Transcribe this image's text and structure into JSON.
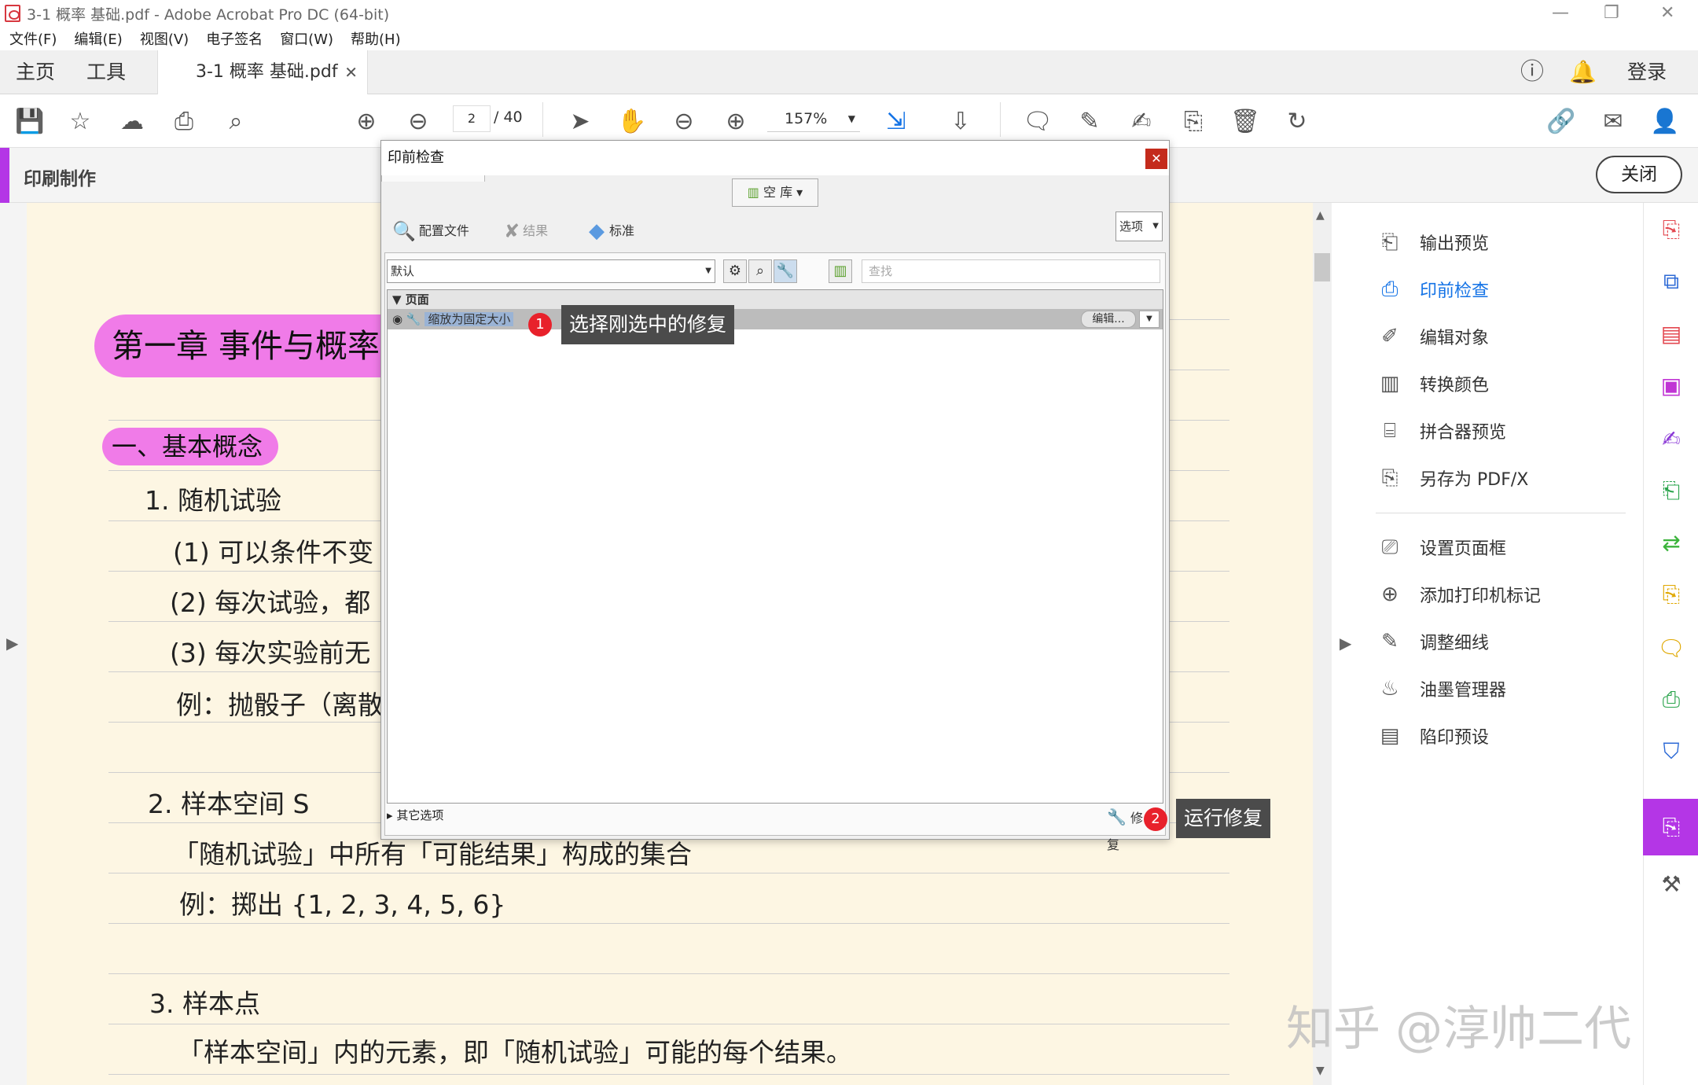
{
  "window": {
    "title": "3-1 概率 基础.pdf - Adobe Acrobat Pro DC (64-bit)"
  },
  "menu": [
    "文件(F)",
    "编辑(E)",
    "视图(V)",
    "电子签名",
    "窗口(W)",
    "帮助(H)"
  ],
  "tabs": {
    "home": "主页",
    "tools": "工具",
    "doc": "3-1 概率 基础.pdf",
    "login": "登录"
  },
  "toolbar": {
    "page_current": "2",
    "page_total": "/ 40",
    "zoom": "157%"
  },
  "printbar": {
    "label": "印刷制作",
    "close": "关闭"
  },
  "document": {
    "chapter": "第一章 事件与概率",
    "section": "一、基本概念",
    "lines": [
      "1. 随机试验",
      "(1) 可以条件不变",
      "(2) 每次试验，都",
      "(3) 每次实验前无",
      "例：抛骰子（离散",
      "2. 样本空间 S",
      "「随机试验」中所有「可能结果」构成的集合",
      "例：掷出 {1, 2, 3, 4, 5, 6}",
      "3. 样本点",
      "「样本空间」内的元素，即「随机试验」可能的每个结果。"
    ]
  },
  "right_panel": {
    "items": [
      "输出预览",
      "印前检查",
      "编辑对象",
      "转换颜色",
      "拼合器预览",
      "另存为 PDF/X",
      "设置页面框",
      "添加打印机标记",
      "调整细线",
      "油墨管理器",
      "陷印预设"
    ]
  },
  "dialog": {
    "title": "印前检查",
    "library": "空 库",
    "tab_profiles": "配置文件",
    "tab_results": "结果",
    "tab_standards": "标准",
    "options": "选项",
    "profile_select": "默认",
    "search_placeholder": "查找",
    "group": "页面",
    "fixup": "缩放为固定大小",
    "edit": "编辑...",
    "other_options": "其它选项",
    "fix_button": "修复"
  },
  "annotations": {
    "marker1": "1",
    "tip1": "选择刚选中的修复",
    "marker2": "2",
    "tip2": "运行修复"
  },
  "watermark": "知乎 @淳帅二代",
  "colors": {
    "accent": "#b436e6",
    "highlight": "#f07be8",
    "marker": "#e8212b",
    "link": "#1473e6"
  }
}
